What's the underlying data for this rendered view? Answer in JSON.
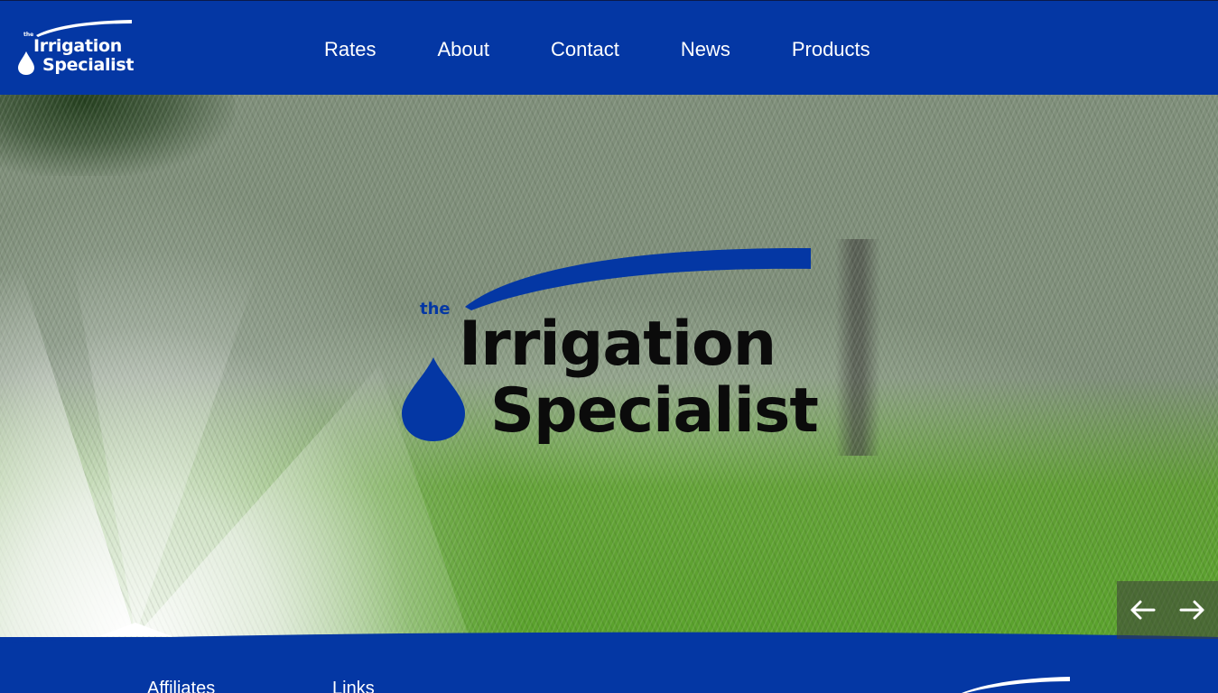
{
  "header": {
    "logo": {
      "the": "the",
      "line1": "Irrigation",
      "line2": "Specialist"
    },
    "nav": [
      "Rates",
      "About",
      "Contact",
      "News",
      "Products"
    ]
  },
  "hero": {
    "logo": {
      "the": "the",
      "line1": "Irrigation",
      "line2": "Specialist"
    },
    "prev_icon": "arrow-left-icon",
    "next_icon": "arrow-right-icon"
  },
  "footer": {
    "col1_heading": "Affiliates",
    "col2_heading": "Links"
  },
  "colors": {
    "brand_blue": "#0437a4",
    "logo_text_dark": "#0b0b0b",
    "white": "#ffffff"
  }
}
